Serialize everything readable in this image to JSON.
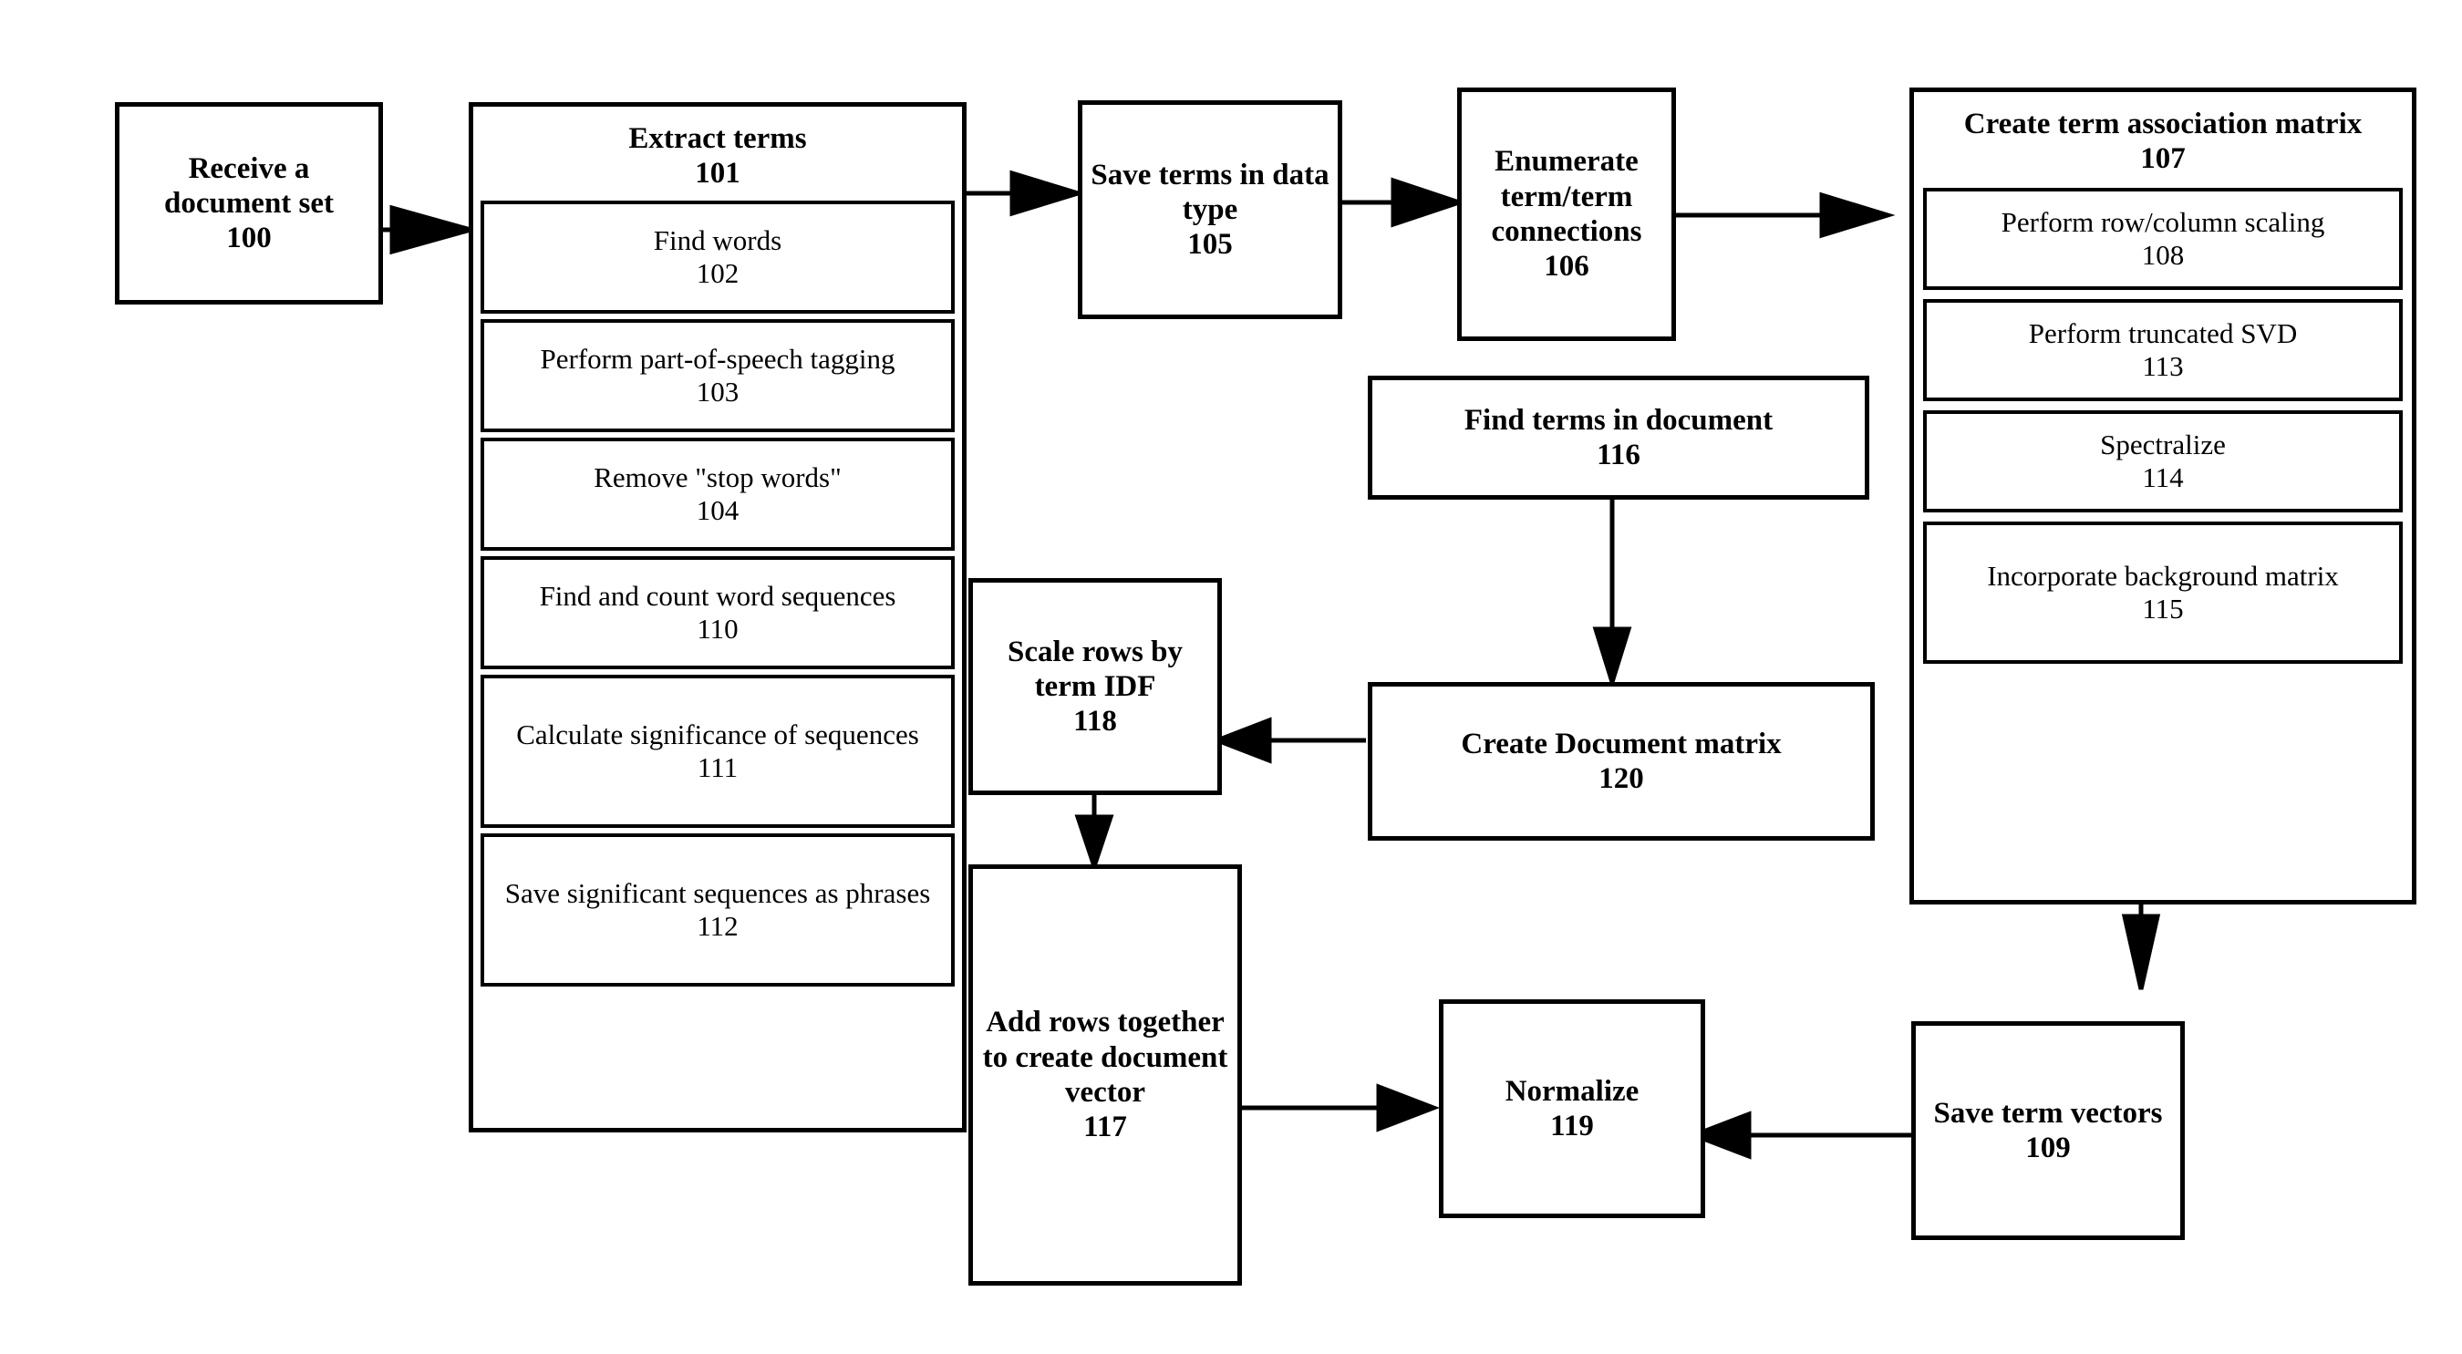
{
  "diagram": {
    "title": "Document vector generation flowchart",
    "line_color": "#000000",
    "box_fill": "#ffffff"
  },
  "nodes": {
    "n100": {
      "label": "Receive a document set",
      "ref": "100"
    },
    "n101": {
      "label": "Extract terms",
      "ref": "101"
    },
    "n102": {
      "label": "Find words",
      "ref": "102"
    },
    "n103": {
      "label": "Perform part-of-speech tagging",
      "ref": "103"
    },
    "n104": {
      "label": "Remove \"stop words\"",
      "ref": "104"
    },
    "n110": {
      "label": "Find and count word sequences",
      "ref": "110"
    },
    "n111": {
      "label": "Calculate significance of sequences",
      "ref": "111"
    },
    "n112": {
      "label": "Save significant sequences as phrases",
      "ref": "112"
    },
    "n105": {
      "label": "Save terms in data type",
      "ref": "105"
    },
    "n106": {
      "label": "Enumerate term/term connections",
      "ref": "106"
    },
    "n107": {
      "label": "Create term association matrix",
      "ref": "107"
    },
    "n108": {
      "label": "Perform row/column scaling",
      "ref": "108"
    },
    "n113": {
      "label": "Perform truncated SVD",
      "ref": "113"
    },
    "n114": {
      "label": "Spectralize",
      "ref": "114"
    },
    "n115": {
      "label": "Incorporate background matrix",
      "ref": "115"
    },
    "n116": {
      "label": "Find terms in document",
      "ref": "116"
    },
    "n120": {
      "label": "Create Document matrix",
      "ref": "120"
    },
    "n118": {
      "label": "Scale rows by term IDF",
      "ref": "118"
    },
    "n117": {
      "label": "Add rows together to create document vector",
      "ref": "117"
    },
    "n119": {
      "label": "Normalize",
      "ref": "119"
    },
    "n109": {
      "label": "Save term vectors",
      "ref": "109"
    }
  },
  "edges": [
    {
      "from": "n100",
      "to": "n101",
      "direction": "right"
    },
    {
      "from": "n101",
      "to": "n105",
      "direction": "right"
    },
    {
      "from": "n105",
      "to": "n106",
      "direction": "right"
    },
    {
      "from": "n106",
      "to": "n107",
      "direction": "right"
    },
    {
      "from": "n116",
      "to": "n120",
      "direction": "down"
    },
    {
      "from": "n120",
      "to": "n118",
      "direction": "left"
    },
    {
      "from": "n118",
      "to": "n117",
      "direction": "down"
    },
    {
      "from": "n117",
      "to": "n119",
      "direction": "right"
    },
    {
      "from": "n107",
      "to": "n109",
      "direction": "down"
    },
    {
      "from": "n109",
      "to": "n119",
      "direction": "left"
    }
  ]
}
